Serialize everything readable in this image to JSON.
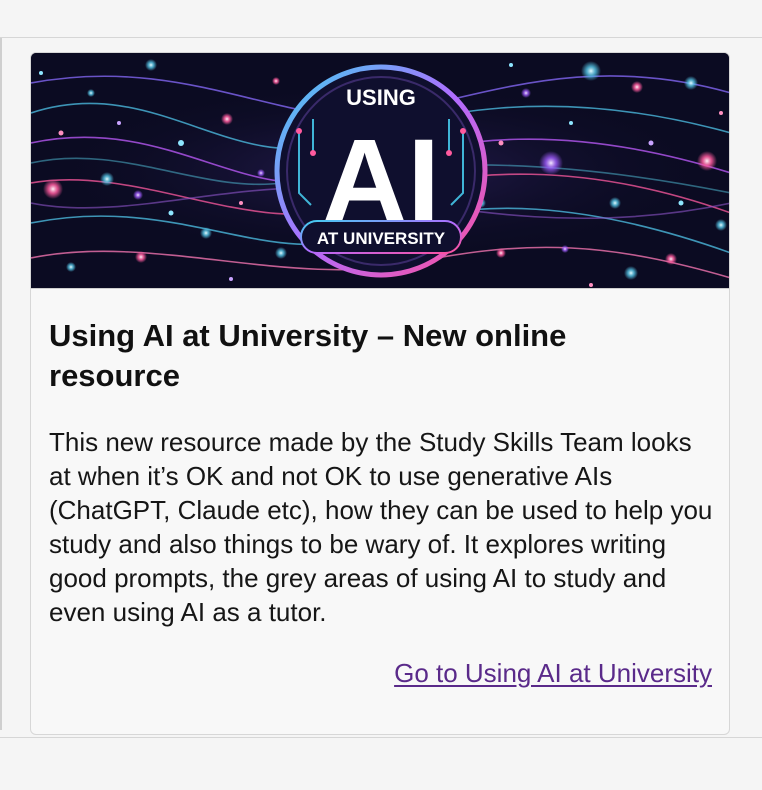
{
  "card": {
    "banner": {
      "alt_top": "USING",
      "alt_main": "AI",
      "alt_bottom": "AT UNIVERSITY"
    },
    "title": "Using AI at University – New online resource",
    "body": "This new resource made by the Study Skills Team looks at when it’s OK and not OK to use generative AIs (ChatGPT, Claude etc), how they can be used to help you study and also things to be wary of. It explores writing good prompts, the grey areas of using AI to study and even using AI as a tutor.",
    "link_label": "Go to Using AI at University"
  },
  "colors": {
    "page_background": "#f5f5f5",
    "card_background": "#f8f8f8",
    "link": "#5a2a8a",
    "banner_background": "#0b0b22"
  }
}
